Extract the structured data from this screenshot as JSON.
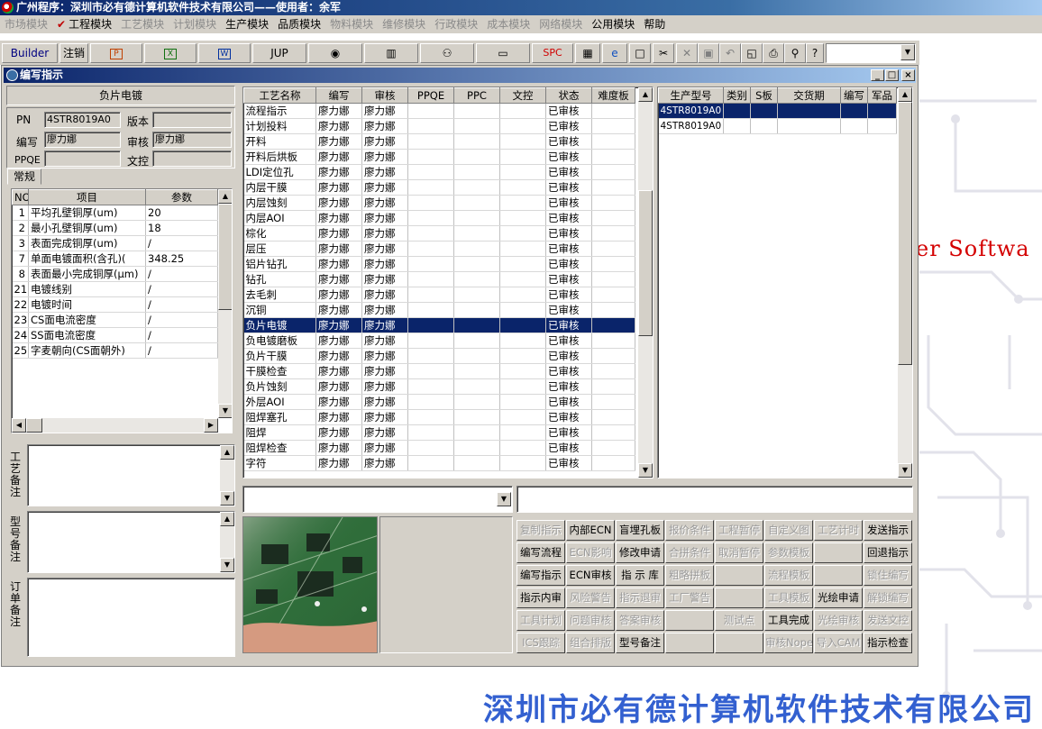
{
  "app": {
    "title": "广州程序：深圳市必有德计算机软件技术有限公司——使用者：余军"
  },
  "menu": [
    {
      "label": "市场模块",
      "enabled": false
    },
    {
      "label": "工程模块",
      "enabled": true,
      "checked": true
    },
    {
      "label": "工艺模块",
      "enabled": false
    },
    {
      "label": "计划模块",
      "enabled": false
    },
    {
      "label": "生产模块",
      "enabled": true
    },
    {
      "label": "品质模块",
      "enabled": true
    },
    {
      "label": "物料模块",
      "enabled": false
    },
    {
      "label": "维修模块",
      "enabled": false
    },
    {
      "label": "行政模块",
      "enabled": false
    },
    {
      "label": "成本模块",
      "enabled": false
    },
    {
      "label": "网络模块",
      "enabled": false
    },
    {
      "label": "公用模块",
      "enabled": true
    },
    {
      "label": "帮助",
      "enabled": true
    }
  ],
  "toolbar": {
    "builder": "Builder",
    "logout": "注销",
    "jup": "JUP",
    "spc": "SPC",
    "icons": [
      "ppt-icon",
      "excel-icon",
      "word-icon",
      "eye-icon",
      "database-icon",
      "users-icon",
      "computer-icon",
      "calculator-icon",
      "ie-icon",
      "new-file-icon",
      "cut-icon",
      "delete-icon",
      "save-icon",
      "undo-icon",
      "preview-icon",
      "print-icon",
      "find-icon",
      "help-icon"
    ]
  },
  "window": {
    "title": "编写指示",
    "process_name": "负片电镀",
    "pn_label": "PN",
    "pn_value": "4STR8019A0",
    "version_label": "版本",
    "version_value": "",
    "writer_label": "编写",
    "writer_value": "廖力娜",
    "reviewer_label": "审核",
    "reviewer_value": "廖力娜",
    "ppqe_label": "PPQE",
    "ppqe_value": "",
    "doc_ctrl_label": "文控",
    "doc_ctrl_value": "",
    "tab_general": "常规"
  },
  "params": {
    "headers": [
      "NO",
      "项目",
      "参数"
    ],
    "rows": [
      [
        "1",
        "平均孔壁铜厚(um)",
        "20"
      ],
      [
        "2",
        "最小孔壁铜厚(um)",
        "18"
      ],
      [
        "3",
        "表面完成铜厚(um)",
        "/"
      ],
      [
        "7",
        "单面电镀面积(含孔)(",
        "348.25"
      ],
      [
        "8",
        "表面最小完成铜厚(μm)",
        "/"
      ],
      [
        "21",
        "电镀线别",
        "/"
      ],
      [
        "22",
        "电镀时间",
        "/"
      ],
      [
        "23",
        "CS面电流密度",
        "/"
      ],
      [
        "24",
        "SS面电流密度",
        "/"
      ],
      [
        "25",
        "字麦朝向(CS面朝外)",
        "/"
      ]
    ]
  },
  "notes": {
    "process_note": "工艺备注",
    "model_note": "型号备注",
    "order_note": "订单备注"
  },
  "process_grid": {
    "headers": [
      "工艺名称",
      "编写",
      "审核",
      "PPQE",
      "PPC",
      "文控",
      "状态",
      "难度板"
    ],
    "selected_index": 14,
    "rows": [
      [
        "流程指示",
        "廖力娜",
        "廖力娜",
        "",
        "",
        "",
        "已审核",
        ""
      ],
      [
        "计划投料",
        "廖力娜",
        "廖力娜",
        "",
        "",
        "",
        "已审核",
        ""
      ],
      [
        "开料",
        "廖力娜",
        "廖力娜",
        "",
        "",
        "",
        "已审核",
        ""
      ],
      [
        "开料后烘板",
        "廖力娜",
        "廖力娜",
        "",
        "",
        "",
        "已审核",
        ""
      ],
      [
        "LDI定位孔",
        "廖力娜",
        "廖力娜",
        "",
        "",
        "",
        "已审核",
        ""
      ],
      [
        "内层干膜",
        "廖力娜",
        "廖力娜",
        "",
        "",
        "",
        "已审核",
        ""
      ],
      [
        "内层蚀刻",
        "廖力娜",
        "廖力娜",
        "",
        "",
        "",
        "已审核",
        ""
      ],
      [
        "内层AOI",
        "廖力娜",
        "廖力娜",
        "",
        "",
        "",
        "已审核",
        ""
      ],
      [
        "棕化",
        "廖力娜",
        "廖力娜",
        "",
        "",
        "",
        "已审核",
        ""
      ],
      [
        "层压",
        "廖力娜",
        "廖力娜",
        "",
        "",
        "",
        "已审核",
        ""
      ],
      [
        "铝片钻孔",
        "廖力娜",
        "廖力娜",
        "",
        "",
        "",
        "已审核",
        ""
      ],
      [
        "钻孔",
        "廖力娜",
        "廖力娜",
        "",
        "",
        "",
        "已审核",
        ""
      ],
      [
        "去毛刺",
        "廖力娜",
        "廖力娜",
        "",
        "",
        "",
        "已审核",
        ""
      ],
      [
        "沉铜",
        "廖力娜",
        "廖力娜",
        "",
        "",
        "",
        "已审核",
        ""
      ],
      [
        "负片电镀",
        "廖力娜",
        "廖力娜",
        "",
        "",
        "",
        "已审核",
        ""
      ],
      [
        "负电镀磨板",
        "廖力娜",
        "廖力娜",
        "",
        "",
        "",
        "已审核",
        ""
      ],
      [
        "负片干膜",
        "廖力娜",
        "廖力娜",
        "",
        "",
        "",
        "已审核",
        ""
      ],
      [
        "干膜检查",
        "廖力娜",
        "廖力娜",
        "",
        "",
        "",
        "已审核",
        ""
      ],
      [
        "负片蚀刻",
        "廖力娜",
        "廖力娜",
        "",
        "",
        "",
        "已审核",
        ""
      ],
      [
        "外层AOI",
        "廖力娜",
        "廖力娜",
        "",
        "",
        "",
        "已审核",
        ""
      ],
      [
        "阻焊塞孔",
        "廖力娜",
        "廖力娜",
        "",
        "",
        "",
        "已审核",
        ""
      ],
      [
        "阻焊",
        "廖力娜",
        "廖力娜",
        "",
        "",
        "",
        "已审核",
        ""
      ],
      [
        "阻焊检查",
        "廖力娜",
        "廖力娜",
        "",
        "",
        "",
        "已审核",
        ""
      ],
      [
        "字符",
        "廖力娜",
        "廖力娜",
        "",
        "",
        "",
        "已审核",
        ""
      ]
    ]
  },
  "model_grid": {
    "headers": [
      "生产型号",
      "类别",
      "S板",
      "交货期",
      "编写",
      "军品"
    ],
    "selected_index": 0,
    "rows": [
      [
        "4STR8019A0",
        "",
        "",
        "",
        "",
        ""
      ],
      [
        "4STR8019A0",
        "",
        "",
        "",
        "",
        ""
      ]
    ]
  },
  "actions": [
    [
      {
        "t": "复制指示",
        "e": false
      },
      {
        "t": "内部ECN",
        "e": true
      },
      {
        "t": "盲埋孔板",
        "e": true
      },
      {
        "t": "报价条件",
        "e": false
      },
      {
        "t": "工程暂停",
        "e": false
      },
      {
        "t": "自定义图",
        "e": false
      },
      {
        "t": "工艺计时",
        "e": false
      },
      {
        "t": "发送指示",
        "e": true
      }
    ],
    [
      {
        "t": "编写流程",
        "e": true
      },
      {
        "t": "ECN影响",
        "e": false
      },
      {
        "t": "修改申请",
        "e": true
      },
      {
        "t": "合拼条件",
        "e": false
      },
      {
        "t": "取消暂停",
        "e": false
      },
      {
        "t": "参数模板",
        "e": false
      },
      {
        "t": "",
        "e": false
      },
      {
        "t": "回退指示",
        "e": true
      }
    ],
    [
      {
        "t": "编写指示",
        "e": true
      },
      {
        "t": "ECN审核",
        "e": true
      },
      {
        "t": "指 示 库",
        "e": true
      },
      {
        "t": "粗略拼板",
        "e": false
      },
      {
        "t": "",
        "e": false
      },
      {
        "t": "流程模板",
        "e": false
      },
      {
        "t": "",
        "e": false
      },
      {
        "t": "锁住编写",
        "e": false
      }
    ],
    [
      {
        "t": "指示内审",
        "e": true
      },
      {
        "t": "风险警告",
        "e": false
      },
      {
        "t": "指示退审",
        "e": false
      },
      {
        "t": "工厂警告",
        "e": false
      },
      {
        "t": "",
        "e": false
      },
      {
        "t": "工具模板",
        "e": false
      },
      {
        "t": "光绘申请",
        "e": true
      },
      {
        "t": "解锁编写",
        "e": false
      }
    ],
    [
      {
        "t": "工具计划",
        "e": false
      },
      {
        "t": "问题审核",
        "e": false
      },
      {
        "t": "答案审核",
        "e": false
      },
      {
        "t": "",
        "e": false
      },
      {
        "t": "测试点",
        "e": false
      },
      {
        "t": "工具完成",
        "e": true
      },
      {
        "t": "光绘审核",
        "e": false
      },
      {
        "t": "发送文控",
        "e": false
      }
    ],
    [
      {
        "t": "ICS跟踪",
        "e": false
      },
      {
        "t": "组合排版",
        "e": false
      },
      {
        "t": "型号备注",
        "e": true
      },
      {
        "t": "",
        "e": false
      },
      {
        "t": "",
        "e": false
      },
      {
        "t": "审核Nope",
        "e": false
      },
      {
        "t": "导入CAM",
        "e": false
      },
      {
        "t": "指示检查",
        "e": true
      }
    ]
  ],
  "background": {
    "brand_right": "er Softwa",
    "brand_bottom": "深圳市必有德计算机软件技术有限公司"
  },
  "colors": {
    "selection": "#0a246a",
    "face": "#d4d0c8",
    "brand_red": "#d40000",
    "brand_blue": "#3360d0"
  }
}
